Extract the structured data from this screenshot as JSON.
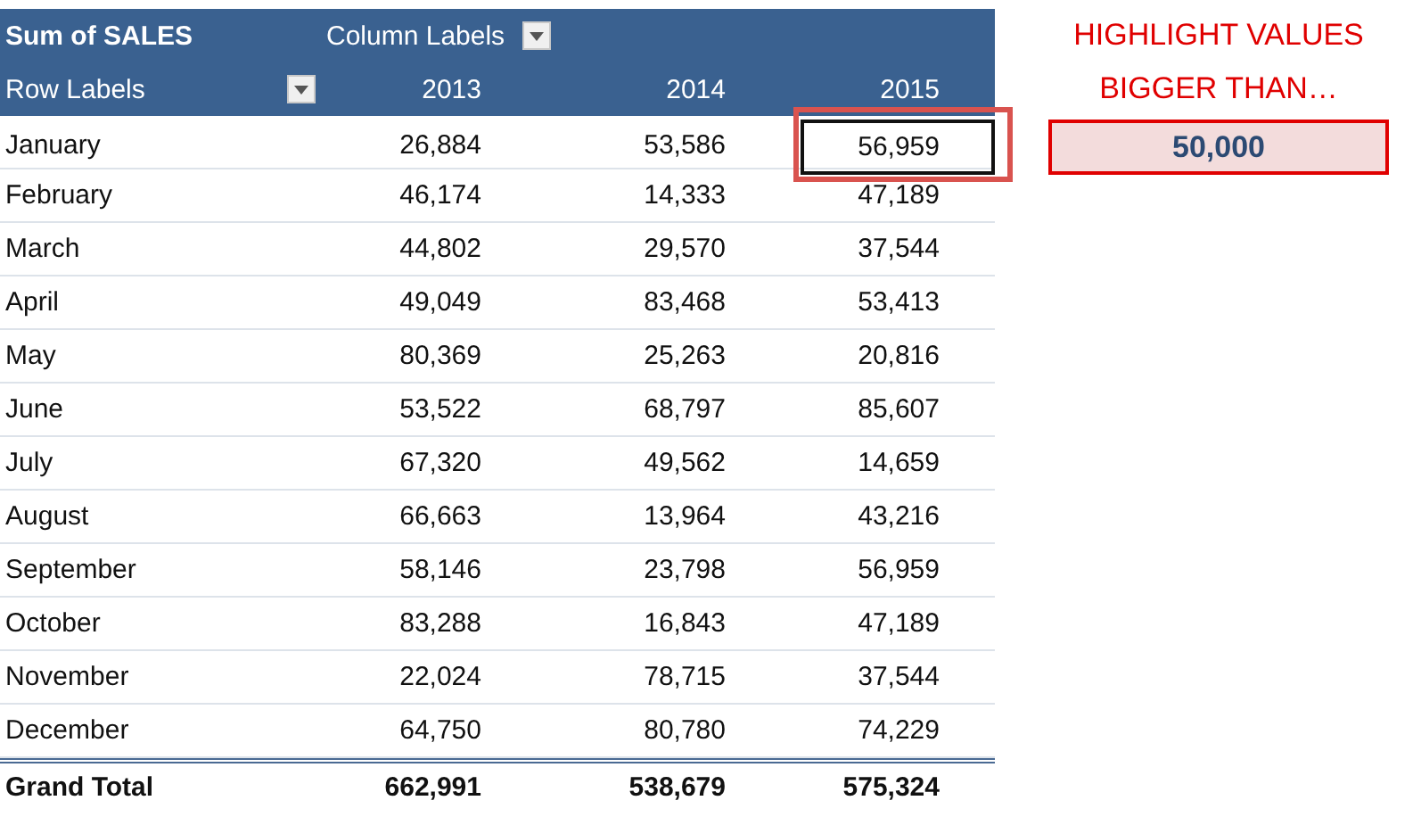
{
  "pivot": {
    "value_field": "Sum of SALES",
    "column_labels": "Column Labels",
    "row_labels": "Row Labels",
    "years": [
      "2013",
      "2014",
      "2015"
    ],
    "rows": [
      {
        "label": "January",
        "cells": [
          {
            "text": "26,884",
            "selected": false
          },
          {
            "text": "53,586",
            "selected": false
          },
          {
            "text": "56,959",
            "selected": true
          }
        ]
      },
      {
        "label": "February",
        "cells": [
          {
            "text": "46,174",
            "selected": false
          },
          {
            "text": "14,333",
            "selected": false
          },
          {
            "text": "47,189",
            "selected": false
          }
        ]
      },
      {
        "label": "March",
        "cells": [
          {
            "text": "44,802",
            "selected": false
          },
          {
            "text": "29,570",
            "selected": false
          },
          {
            "text": "37,544",
            "selected": false
          }
        ]
      },
      {
        "label": "April",
        "cells": [
          {
            "text": "49,049",
            "selected": false
          },
          {
            "text": "83,468",
            "selected": false
          },
          {
            "text": "53,413",
            "selected": false
          }
        ]
      },
      {
        "label": "May",
        "cells": [
          {
            "text": "80,369",
            "selected": false
          },
          {
            "text": "25,263",
            "selected": false
          },
          {
            "text": "20,816",
            "selected": false
          }
        ]
      },
      {
        "label": "June",
        "cells": [
          {
            "text": "53,522",
            "selected": false
          },
          {
            "text": "68,797",
            "selected": false
          },
          {
            "text": "85,607",
            "selected": false
          }
        ]
      },
      {
        "label": "July",
        "cells": [
          {
            "text": "67,320",
            "selected": false
          },
          {
            "text": "49,562",
            "selected": false
          },
          {
            "text": "14,659",
            "selected": false
          }
        ]
      },
      {
        "label": "August",
        "cells": [
          {
            "text": "66,663",
            "selected": false
          },
          {
            "text": "13,964",
            "selected": false
          },
          {
            "text": "43,216",
            "selected": false
          }
        ]
      },
      {
        "label": "September",
        "cells": [
          {
            "text": "58,146",
            "selected": false
          },
          {
            "text": "23,798",
            "selected": false
          },
          {
            "text": "56,959",
            "selected": false
          }
        ]
      },
      {
        "label": "October",
        "cells": [
          {
            "text": "83,288",
            "selected": false
          },
          {
            "text": "16,843",
            "selected": false
          },
          {
            "text": "47,189",
            "selected": false
          }
        ]
      },
      {
        "label": "November",
        "cells": [
          {
            "text": "22,024",
            "selected": false
          },
          {
            "text": "78,715",
            "selected": false
          },
          {
            "text": "37,544",
            "selected": false
          }
        ]
      },
      {
        "label": "December",
        "cells": [
          {
            "text": "64,750",
            "selected": false
          },
          {
            "text": "80,780",
            "selected": false
          },
          {
            "text": "74,229",
            "selected": false
          }
        ]
      }
    ],
    "grand_total": {
      "label": "Grand Total",
      "values": [
        "662,991",
        "538,679",
        "575,324"
      ]
    }
  },
  "highlight": {
    "lines": [
      "HIGHLIGHT VALUES",
      "BIGGER THAN…"
    ],
    "value": "50,000"
  }
}
